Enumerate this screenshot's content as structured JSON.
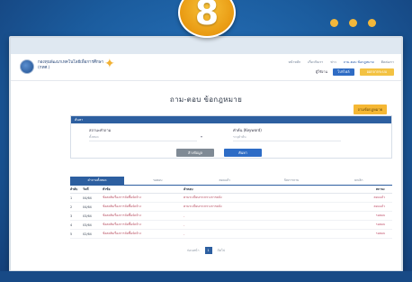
{
  "step_number": "8",
  "header": {
    "org_name": "กองทุนพัฒนาเทคโนโลยีเพื่อการศึกษา (กทศ.)",
    "nav": [
      "หน้าหลัก",
      "เกี่ยวกับเรา",
      "ข่าว",
      "ถาม-ตอบ ข้อกฎหมาย",
      "ติดต่อเรา"
    ],
    "nav_cta": "เข้าสู่ระบบ",
    "user_name": "ผู้ใช้งาน",
    "logout_label": "ออกจากระบบ",
    "profile_label": "โปรไฟล์"
  },
  "page_title": "ถาม-ตอบ ข้อกฎหมาย",
  "ask_button": "ถามข้อกฎหมาย",
  "filter": {
    "title": "ค้นหา",
    "category_label": "สถานะคำถาม",
    "category_value": "ทั้งหมด",
    "keyword_label": "คำค้น (Keyword)",
    "keyword_placeholder": "ระบุคำค้น",
    "clear_label": "ล้างข้อมูล",
    "search_label": "ค้นหา"
  },
  "tabs": [
    "คำถามทั้งหมด",
    "รอตอบ",
    "ตอบแล้ว",
    "ปิดการถาม",
    "ยกเลิก"
  ],
  "table": {
    "headers": [
      "ลำดับ",
      "วันที่",
      "หัวข้อ",
      "คำตอบ",
      "สถานะ"
    ],
    "rows": [
      {
        "no": "1",
        "date": "04/64",
        "topic": "ข้อสงสัยเรื่องการจัดซื้อจัดจ้าง",
        "answer": "ตามระเบียบกระทรวงการคลัง",
        "status": "ตอบแล้ว"
      },
      {
        "no": "2",
        "date": "04/64",
        "topic": "ข้อสงสัยเรื่องการจัดซื้อจัดจ้าง",
        "answer": "ตามระเบียบกระทรวงการคลัง",
        "status": "ตอบแล้ว"
      },
      {
        "no": "3",
        "date": "03/64",
        "topic": "ข้อสงสัยเรื่องการจัดซื้อจัดจ้าง",
        "answer": "-",
        "status": "รอตอบ"
      },
      {
        "no": "4",
        "date": "03/64",
        "topic": "ข้อสงสัยเรื่องการจัดซื้อจัดจ้าง",
        "answer": "-",
        "status": "รอตอบ"
      },
      {
        "no": "5",
        "date": "02/64",
        "topic": "ข้อสงสัยเรื่องการจัดซื้อจัดจ้าง",
        "answer": "-",
        "status": "รอตอบ"
      }
    ]
  },
  "pager": {
    "prev": "ก่อนหน้า",
    "current": "1",
    "next": "ถัดไป"
  },
  "colors": {
    "primary": "#2d5fa0",
    "accent": "#f5b734"
  }
}
